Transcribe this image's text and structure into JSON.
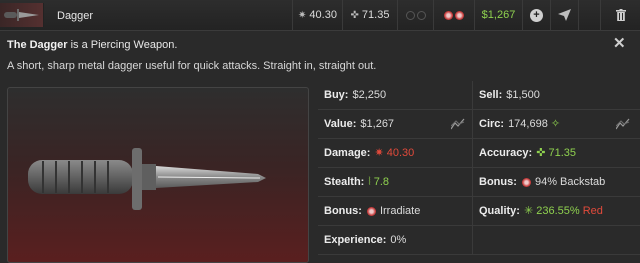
{
  "item": {
    "name": "Dagger",
    "damage": "40.30",
    "accuracy": "71.35",
    "price": "$1,267"
  },
  "info": {
    "title_name": "The Dagger",
    "title_suffix": " is a Piercing Weapon.",
    "description": "A short, sharp metal dagger useful for quick attacks. Straight in, straight out.",
    "close": "✕"
  },
  "stats": {
    "buy_label": "Buy:",
    "buy_value": "$2,250",
    "sell_label": "Sell:",
    "sell_value": "$1,500",
    "value_label": "Value:",
    "value_value": "$1,267",
    "circ_label": "Circ:",
    "circ_value": "174,698",
    "damage_label": "Damage:",
    "damage_value": "40.30",
    "accuracy_label": "Accuracy:",
    "accuracy_value": "71.35",
    "stealth_label": "Stealth:",
    "stealth_value": "7.8",
    "bonus1_label": "Bonus:",
    "bonus1_value": "94% Backstab",
    "bonus2_label": "Bonus:",
    "bonus2_value": "Irradiate",
    "quality_label": "Quality:",
    "quality_value": "236.55%",
    "quality_tier": "Red",
    "experience_label": "Experience:",
    "experience_value": "0%"
  },
  "icons": {
    "damage": "star-burst-icon",
    "accuracy": "crosshair-icon",
    "stealth": "stealth-icon",
    "bonus": "bonus-badge-icon",
    "add": "plus-circle-icon",
    "send": "send-icon",
    "trash": "trash-icon",
    "trend": "trend-chart-icon",
    "circ": "circulation-icon",
    "quality": "sparkle-icon"
  },
  "colors": {
    "price_green": "#8fd14f",
    "damage_red": "#e24a3b",
    "quality_red": "#e24a3b"
  }
}
